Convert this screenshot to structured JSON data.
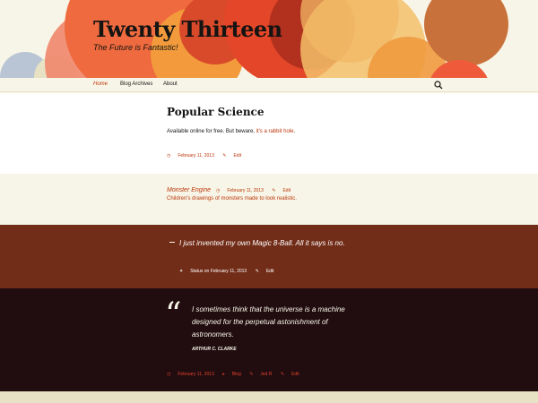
{
  "header": {
    "title": "Twenty Thirteen",
    "description": "The Future is Fantastic!"
  },
  "nav": {
    "items": [
      {
        "label": "Home",
        "active": true
      },
      {
        "label": "Blog Archives",
        "active": false
      },
      {
        "label": "About",
        "active": false
      }
    ],
    "search_icon": "search-icon"
  },
  "posts": [
    {
      "title": "Popular Science",
      "text_before": "Available online for free. But beware, ",
      "link_text": "it's a rabbit hole",
      "text_after": ".",
      "date": "February 11, 2013",
      "edit": "Edit"
    },
    {
      "title": "Monster Engine",
      "date": "February 11, 2013",
      "edit": "Edit",
      "description": "Children's drawings of monsters made to look realistic."
    },
    {
      "status": "I just invented my own Magic 8-Ball. All it says is no.",
      "meta_prefix": "Status on February 11, 2013",
      "edit": "Edit"
    },
    {
      "quote_mark": "“",
      "quote": "I sometimes think that the universe is a machine designed for the perpetual astonishment of astronomers.",
      "author": "ARTHUR C. CLARKE",
      "date": "February 11, 2013",
      "category": "Blog",
      "comments": "Jed R",
      "edit": "Edit"
    }
  ],
  "colors": {
    "accent": "#bc360a",
    "background": "#f7f5e7",
    "status_bg": "#722d19",
    "quote_bg": "#210d10"
  }
}
